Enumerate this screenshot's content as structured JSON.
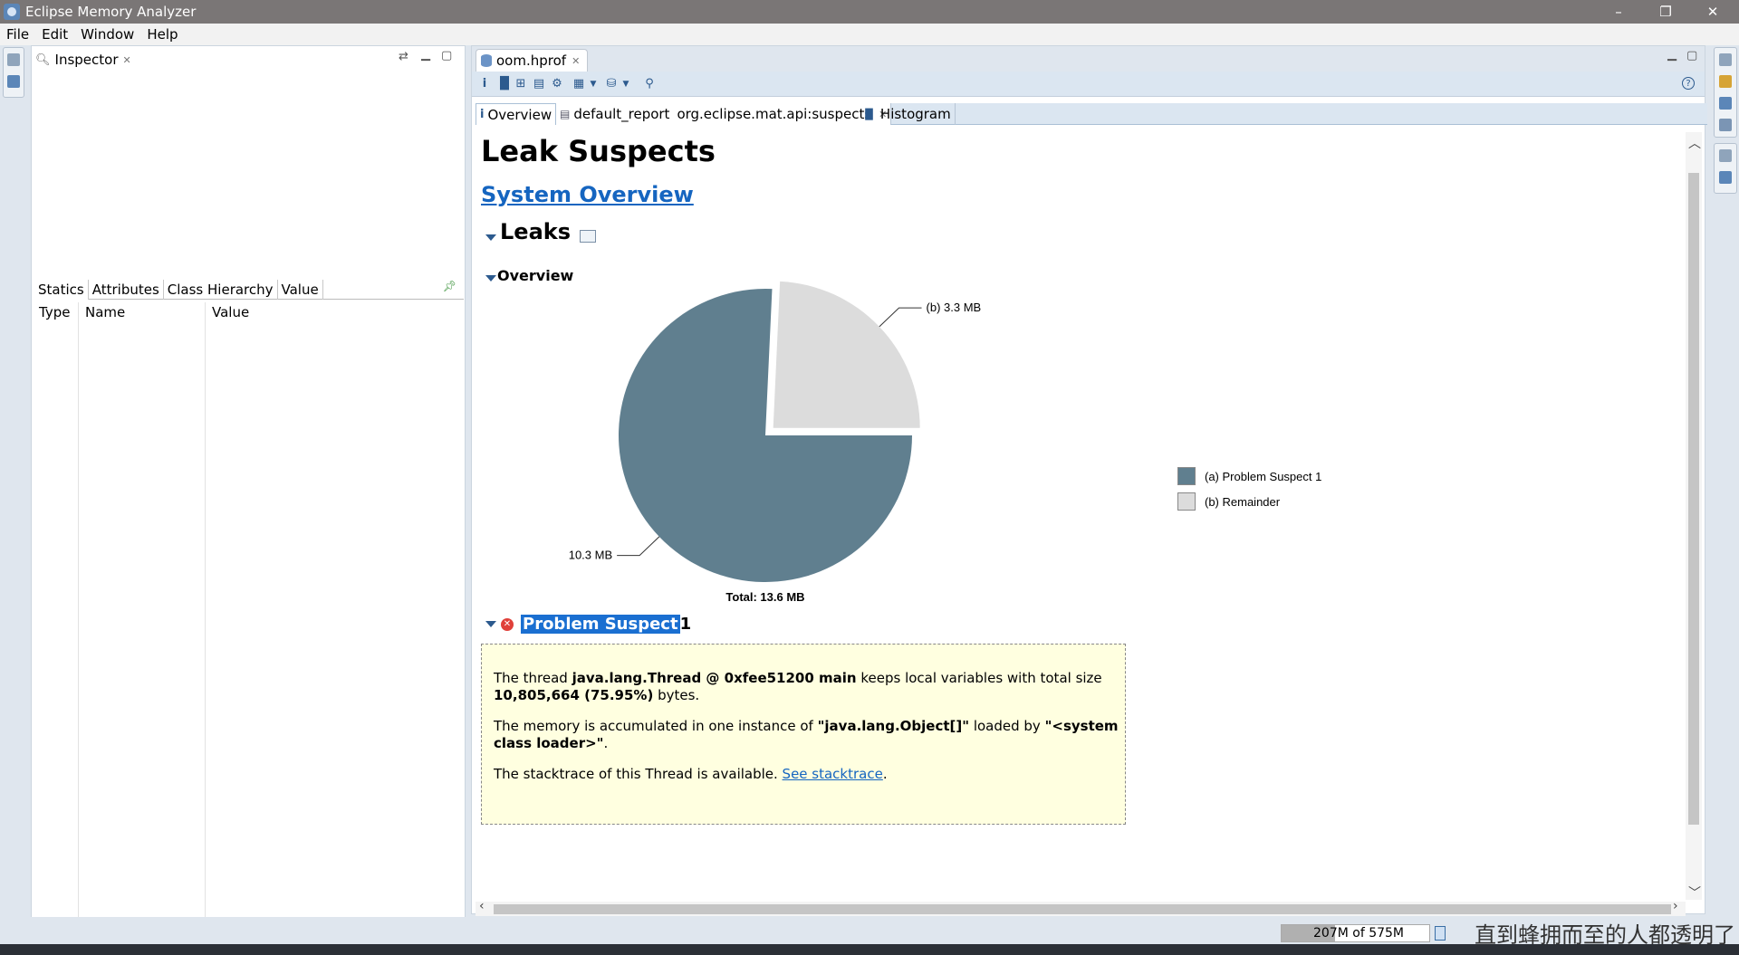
{
  "window": {
    "title": "Eclipse Memory Analyzer",
    "minimize": "–",
    "restore": "❐",
    "close": "✕"
  },
  "menu": [
    {
      "label": "File"
    },
    {
      "label": "Edit"
    },
    {
      "label": "Window"
    },
    {
      "label": "Help"
    }
  ],
  "inspector": {
    "tab_label": "Inspector",
    "close": "✕",
    "sub_tabs": [
      "Statics",
      "Attributes",
      "Class Hierarchy",
      "Value"
    ],
    "columns": [
      "Type",
      "Name",
      "Value"
    ]
  },
  "editor": {
    "tab_label": "oom.hprof",
    "close": "✕",
    "report_tabs": {
      "overview": "Overview",
      "report_name": "default_report",
      "report_id": "org.eclipse.mat.api:suspects",
      "histogram": "Histogram",
      "close": "✕"
    }
  },
  "report": {
    "title": "Leak Suspects",
    "system_overview": "System Overview",
    "leaks_heading": "Leaks",
    "overview_heading": "Overview",
    "problem_suspect_highlight": "Problem Suspect",
    "problem_suspect_number": "1",
    "desc": {
      "p1_pre": "The thread ",
      "p1_bold1": "java.lang.Thread @ 0xfee51200 main",
      "p1_mid": " keeps local variables with total size ",
      "p1_bold2": "10,805,664 (75.95%)",
      "p1_post": " bytes.",
      "p2_pre": "The memory is accumulated in one instance of ",
      "p2_bold1": "\"java.lang.Object[]\"",
      "p2_mid": " loaded by ",
      "p2_bold2": "\"<system class loader>\"",
      "p2_post": ".",
      "p3_pre": "The stacktrace of this Thread is available. ",
      "p3_link": "See stacktrace",
      "p3_post": "."
    }
  },
  "chart_data": {
    "type": "pie",
    "title": "",
    "slices": [
      {
        "id": "a",
        "label": "(a)  10.3 MB",
        "legend": "(a)  Problem Suspect 1",
        "value": 10.3,
        "color": "#607f8f"
      },
      {
        "id": "b",
        "label": "(b)  3.3 MB",
        "legend": "(b)  Remainder",
        "value": 3.3,
        "color": "#dcdcdc"
      }
    ],
    "total_label": "Total: 13.6 MB",
    "legend_position": "right"
  },
  "status": {
    "heap_text": "207M of 575M",
    "heap_used_fraction": 0.36,
    "watermark": "直到蜂拥而至的人都透明了"
  },
  "colors": {
    "accent": "#1565c0",
    "highlight": "#1a6fd1",
    "suspect_box": "#ffffe0"
  }
}
